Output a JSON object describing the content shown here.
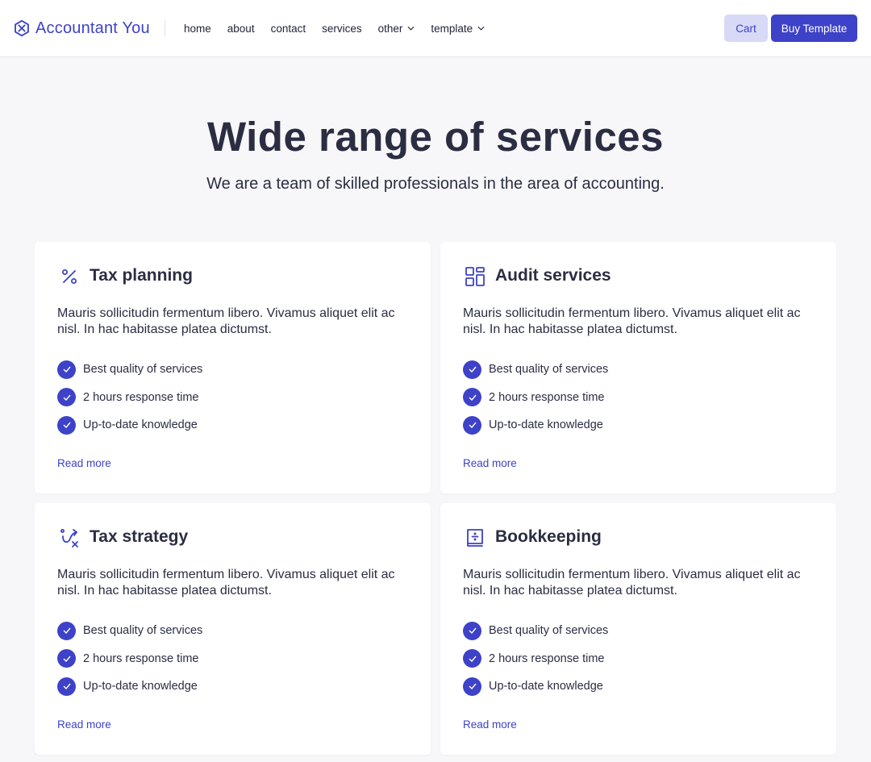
{
  "header": {
    "brand_name": "Accountant You",
    "brand_icon": "hexagon-logo-icon",
    "nav": [
      {
        "label": "home"
      },
      {
        "label": "about"
      },
      {
        "label": "contact"
      },
      {
        "label": "services"
      },
      {
        "label": "other",
        "dropdown": true
      },
      {
        "label": "template",
        "dropdown": true
      }
    ],
    "cart_label": "Cart",
    "buy_label": "Buy Template"
  },
  "hero": {
    "title": "Wide range of services",
    "subtitle": "We are a team of skilled professionals in the area of accounting."
  },
  "cards": [
    {
      "icon": "percent-icon",
      "title": "Tax planning",
      "description": "Mauris sollicitudin fermentum libero. Vivamus aliquet elit ac nisl. In hac habitasse platea dictumst.",
      "features": [
        "Best quality of services",
        "2 hours response time",
        "Up-to-date knowledge"
      ],
      "link": "Read more"
    },
    {
      "icon": "layout-grid-icon",
      "title": "Audit services",
      "description": "Mauris sollicitudin fermentum libero. Vivamus aliquet elit ac nisl. In hac habitasse platea dictumst.",
      "features": [
        "Best quality of services",
        "2 hours response time",
        "Up-to-date knowledge"
      ],
      "link": "Read more"
    },
    {
      "icon": "strategy-icon",
      "title": "Tax strategy",
      "description": "Mauris sollicitudin fermentum libero. Vivamus aliquet elit ac nisl. In hac habitasse platea dictumst.",
      "features": [
        "Best quality of services",
        "2 hours response time",
        "Up-to-date knowledge"
      ],
      "link": "Read more"
    },
    {
      "icon": "ledger-icon",
      "title": "Bookkeeping",
      "description": "Mauris sollicitudin fermentum libero. Vivamus aliquet elit ac nisl. In hac habitasse platea dictumst.",
      "features": [
        "Best quality of services",
        "2 hours response time",
        "Up-to-date knowledge"
      ],
      "link": "Read more"
    }
  ],
  "colors": {
    "accent": "#3d42c8",
    "accent_soft": "#d8d9f6",
    "text": "#2b2d42",
    "background": "#f7f7f9",
    "card": "#ffffff"
  }
}
